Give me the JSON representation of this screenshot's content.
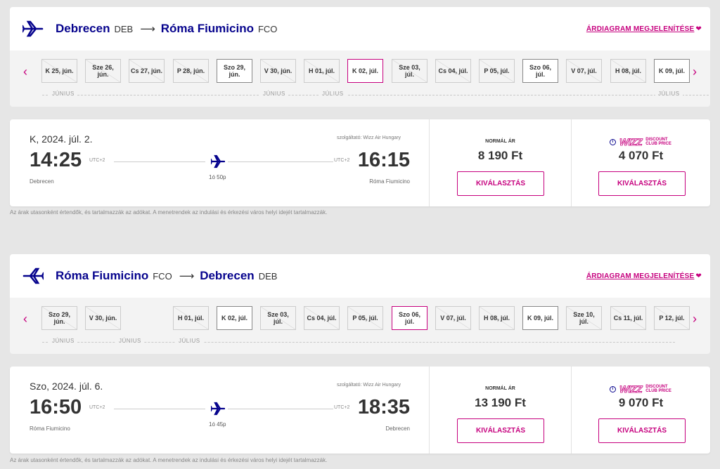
{
  "legs": [
    {
      "header": {
        "from_city": "Debrecen",
        "from_code": "DEB",
        "arrow": "⟶",
        "to_city": "Róma Fiumicino",
        "to_code": "FCO",
        "price_chart_link": "ÁRDIAGRAM MEGJELENÍTÉSE",
        "heart": "❤"
      },
      "nav": {
        "prev": "‹",
        "next": "›"
      },
      "dates": [
        {
          "label": "K 25, jún.",
          "state": "nf"
        },
        {
          "label": "Sze 26, jún.",
          "state": "nf"
        },
        {
          "label": "Cs 27, jún.",
          "state": "nf"
        },
        {
          "label": "P 28, jún.",
          "state": "nf"
        },
        {
          "label": "Szo 29, jún.",
          "state": "avail"
        },
        {
          "label": "V 30, jún.",
          "state": "nf"
        },
        {
          "label": "H 01, júl.",
          "state": "nf"
        },
        {
          "label": "K 02, júl.",
          "state": "selected"
        },
        {
          "label": "Sze 03, júl.",
          "state": "nf"
        },
        {
          "label": "Cs 04, júl.",
          "state": "nf"
        },
        {
          "label": "P 05, júl.",
          "state": "nf"
        },
        {
          "label": "Szo 06, júl.",
          "state": "avail"
        },
        {
          "label": "V 07, júl.",
          "state": "nf"
        },
        {
          "label": "H 08, júl.",
          "state": "nf"
        },
        {
          "label": "K 09, júl.",
          "state": "avail"
        }
      ],
      "months": {
        "m1": "JÚNIUS",
        "m2": "JÚNIUS",
        "m3": "JÚLIUS",
        "m4": "JÚLIUS"
      },
      "flight": {
        "date": "K, 2024. júl. 2.",
        "provider": "szolgáltató: Wizz Air Hungary",
        "dep_time": "14:25",
        "arr_time": "16:15",
        "utc_dep": "UTC+2",
        "utc_arr": "UTC+2",
        "duration": "1ó 50p",
        "from_city": "Debrecen",
        "to_city": "Róma Fiumicino",
        "normal_label": "NORMÁL ÁR",
        "normal_price": "8 190 Ft",
        "club_price": "4 070 Ft",
        "select_label": "KIVÁLASZTÁS"
      },
      "disclaimer": "Az árak utasonként értendők, és tartalmazzák az adókat. A menetrendek az indulási és érkezési város helyi idejét tartalmazzák."
    },
    {
      "header": {
        "from_city": "Róma Fiumicino",
        "from_code": "FCO",
        "arrow": "⟶",
        "to_city": "Debrecen",
        "to_code": "DEB",
        "price_chart_link": "ÁRDIAGRAM MEGJELENÍTÉSE",
        "heart": "❤"
      },
      "nav": {
        "prev": "‹",
        "next": "›"
      },
      "dates": [
        {
          "label": "Szo 29, jún.",
          "state": "nf"
        },
        {
          "label": "V 30, jún.",
          "state": "nf"
        },
        {
          "label": "",
          "state": "gap"
        },
        {
          "label": "H 01, júl.",
          "state": "nf"
        },
        {
          "label": "K 02, júl.",
          "state": "avail"
        },
        {
          "label": "Sze 03, júl.",
          "state": "nf"
        },
        {
          "label": "Cs 04, júl.",
          "state": "nf"
        },
        {
          "label": "P 05, júl.",
          "state": "nf"
        },
        {
          "label": "Szo 06, júl.",
          "state": "selected"
        },
        {
          "label": "V 07, júl.",
          "state": "nf"
        },
        {
          "label": "H 08, júl.",
          "state": "nf"
        },
        {
          "label": "K 09, júl.",
          "state": "avail"
        },
        {
          "label": "Sze 10, júl.",
          "state": "nf"
        },
        {
          "label": "Cs 11, júl.",
          "state": "nf"
        },
        {
          "label": "P 12, júl.",
          "state": "nf"
        }
      ],
      "months": {
        "m1": "JÚNIUS",
        "m2": "JÚNIUS",
        "m3": "JÚLIUS"
      },
      "flight": {
        "date": "Szo, 2024. júl. 6.",
        "provider": "szolgáltató: Wizz Air Hungary",
        "dep_time": "16:50",
        "arr_time": "18:35",
        "utc_dep": "UTC+2",
        "utc_arr": "UTC+2",
        "duration": "1ó 45p",
        "from_city": "Róma Fiumicino",
        "to_city": "Debrecen",
        "normal_label": "NORMÁL ÁR",
        "normal_price": "13 190 Ft",
        "club_price": "9 070 Ft",
        "select_label": "KIVÁLASZTÁS"
      },
      "disclaimer": "Az árak utasonként értendők, és tartalmazzák az adókat. A menetrendek az indulási és érkezési város helyi idejét tartalmazzák."
    }
  ],
  "club_badge": {
    "info": "i",
    "wizz": "WIZZ",
    "line1": "DISCOUNT",
    "line2": "CLUB PRICE"
  },
  "colors": {
    "brand_blue": "#06038d",
    "brand_pink": "#c6007e",
    "background": "#e6e6e6"
  },
  "icons": {
    "header_plane": "plane-outbound-icon",
    "return_plane": "plane-return-icon",
    "flight_plane": "plane-icon"
  }
}
